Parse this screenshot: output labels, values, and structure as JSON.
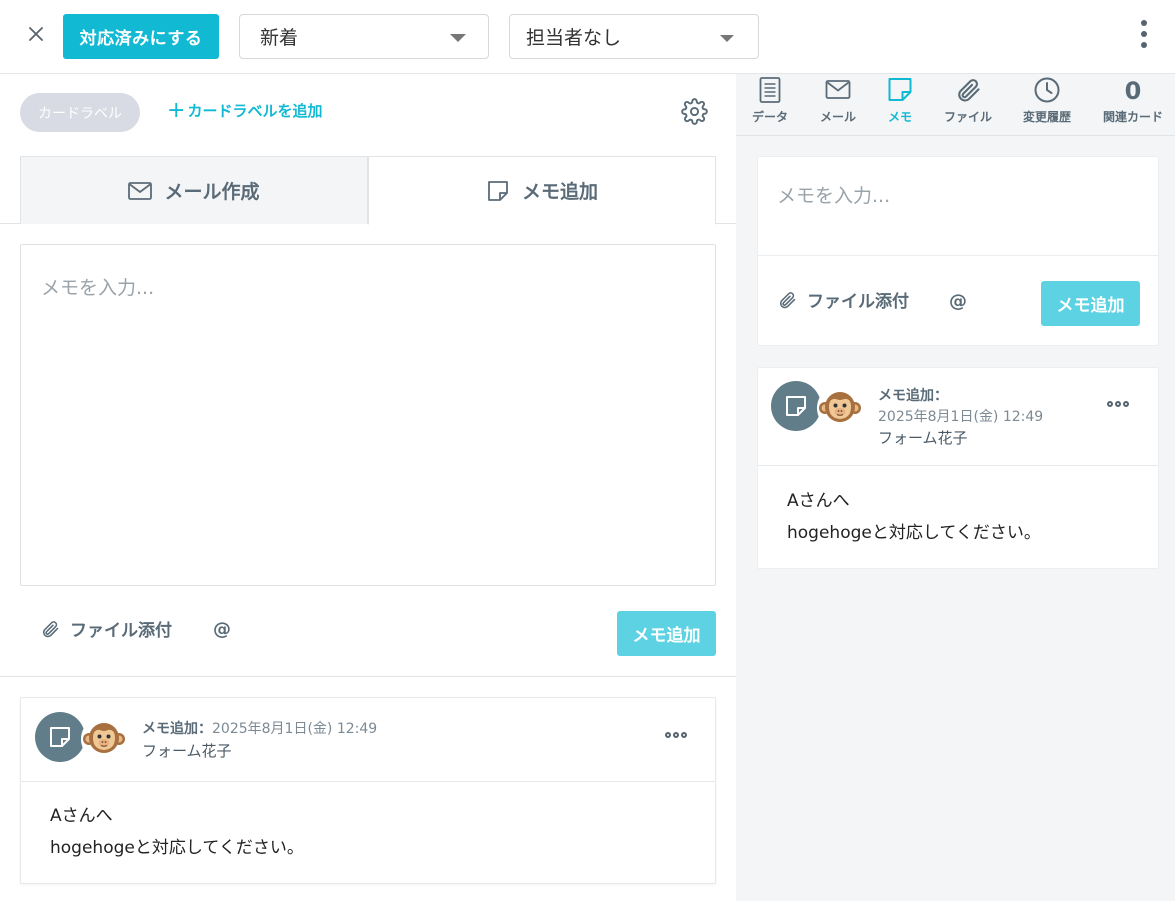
{
  "topbar": {
    "resolve_label": "対応済みにする",
    "status_value": "新着",
    "assignee_value": "担当者なし"
  },
  "left": {
    "card_label": "カードラベル",
    "add_label": "カードラベルを追加",
    "tabs": {
      "mail": "メール作成",
      "memo": "メモ追加"
    },
    "memo_placeholder": "メモを入力...",
    "attach_label": "ファイル添付",
    "mention_label": "@",
    "submit_label": "メモ追加"
  },
  "entry": {
    "title": "メモ追加：",
    "date": "2025年8月1日(金) 12:49",
    "author": "フォーム花子",
    "line1": "Aさんへ",
    "line2": "hogehogeと対応してください。"
  },
  "sidebar": {
    "tabs": [
      {
        "label": "データ",
        "icon": "document-icon"
      },
      {
        "label": "メール",
        "icon": "mail-icon"
      },
      {
        "label": "メモ",
        "icon": "memo-icon",
        "active": true
      },
      {
        "label": "ファイル",
        "icon": "paperclip-icon"
      },
      {
        "label": "変更履歴",
        "icon": "clock-icon"
      },
      {
        "label": "関連カード",
        "count": "0"
      }
    ],
    "memo_placeholder": "メモを入力...",
    "attach_label": "ファイル添付",
    "mention_label": "@",
    "submit_label": "メモ追加"
  },
  "colors": {
    "accent": "#12b9d3",
    "accent_light": "#5dd2e2",
    "icon_gray": "#5a6b78",
    "memo_circle": "#627d8a"
  }
}
